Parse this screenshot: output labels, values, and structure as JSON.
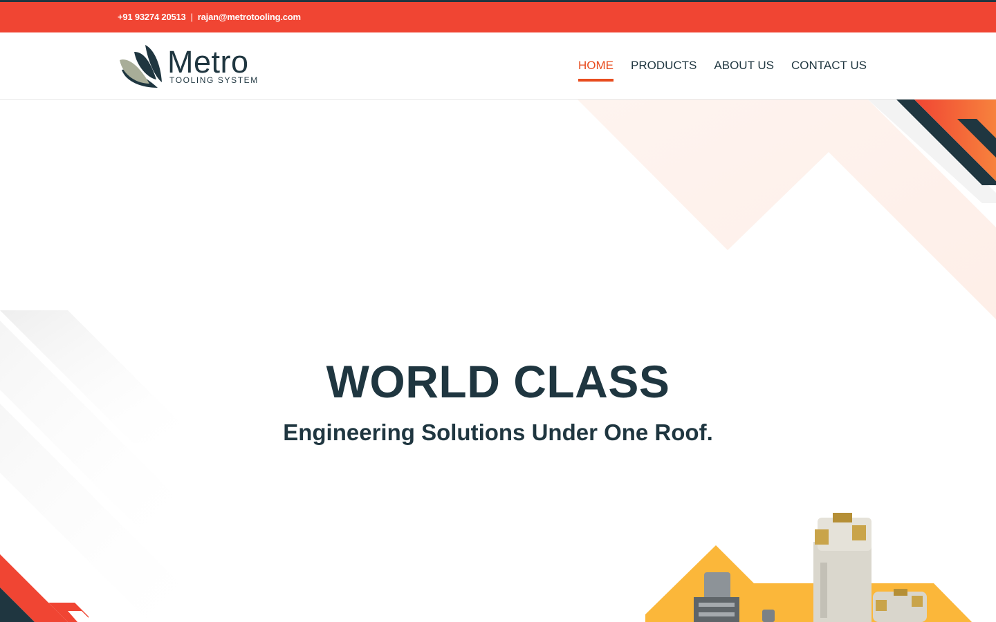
{
  "topbar": {
    "phone": "+91 93274 20513",
    "separator": "|",
    "email": "rajan@metrotooling.com"
  },
  "logo": {
    "brand": "Metro",
    "tagline": "TOOLING SYSTEM"
  },
  "nav": {
    "items": [
      {
        "label": "HOME",
        "active": true
      },
      {
        "label": "PRODUCTS",
        "active": false
      },
      {
        "label": "ABOUT US",
        "active": false
      },
      {
        "label": "CONTACT US",
        "active": false
      }
    ]
  },
  "hero": {
    "title": "WORLD CLASS",
    "subtitle": "Engineering Solutions Under One Roof."
  },
  "colors": {
    "accent": "#f04533",
    "nav_active": "#e84c1e",
    "dark": "#1f3640",
    "yellow": "#fbb73a",
    "logo_sage": "#a8ad98"
  },
  "icons": {
    "logo_mark": "metro-swoosh-icon",
    "product_image": "milling-cutter-tools"
  }
}
